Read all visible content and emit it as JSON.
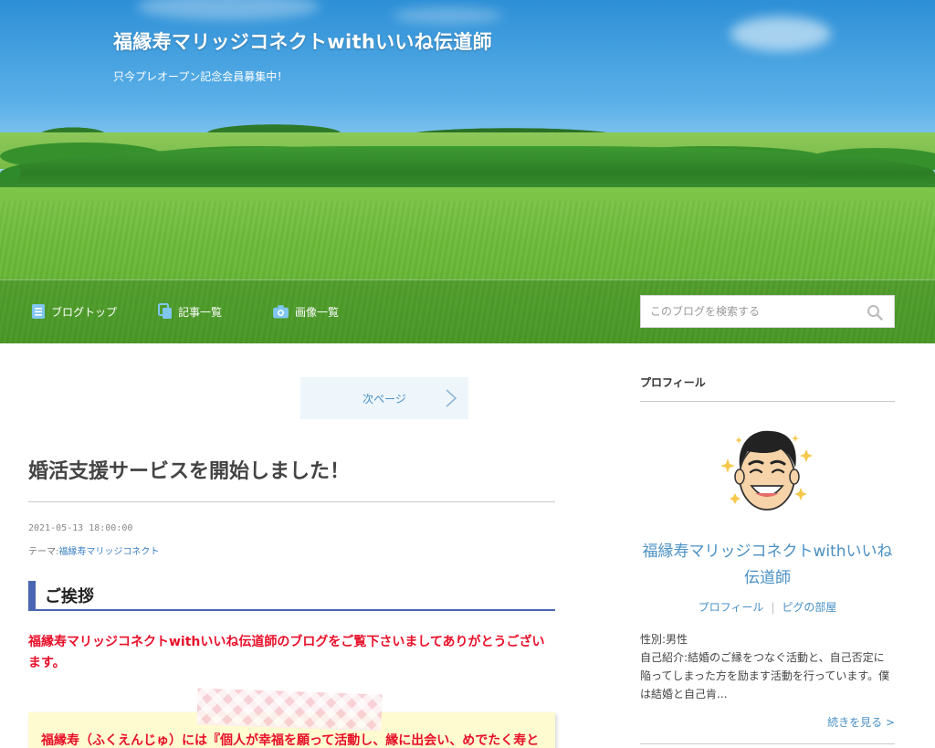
{
  "header": {
    "site_title": "福縁寿マリッジコネクトwithいいね伝道師",
    "site_description": "只今プレオープン記念会員募集中！"
  },
  "nav": {
    "items": [
      {
        "label": "ブログトップ",
        "icon": "list-document-icon"
      },
      {
        "label": "記事一覧",
        "icon": "copy-pages-icon"
      },
      {
        "label": "画像一覧",
        "icon": "camera-icon"
      }
    ],
    "search_placeholder": "このブログを検索する",
    "search_icon": "magnifier-icon"
  },
  "pager": {
    "next_label": "次ページ"
  },
  "post": {
    "title": "婚活支援サービスを開始しました！",
    "date": "2021-05-13 18:00:00",
    "theme_prefix": "テーマ:",
    "theme_link": "福縁寿マリッジコネクト",
    "section_heading": "ご挨拶",
    "greeting": "福縁寿マリッジコネクトwithいいね伝道師のブログをご覧下さいましてありがとうございます。",
    "note_text": "福縁寿（ふくえんじゅ）には『個人が幸福を願って活動し、縁に出会い、めでたく寿と"
  },
  "sidebar": {
    "profile_heading": "プロフィール",
    "profile_name": "福縁寿マリッジコネクトwithいいね伝道師",
    "link_profile": "プロフィール",
    "link_separator": "|",
    "link_room": "ピグの部屋",
    "gender": "性別:男性",
    "intro": "自己紹介:結婚のご縁をつなぐ活動と、自己否定に陥ってしまった方を励ます活動を行っています。僕は結婚と自己肯...",
    "read_more": "続きを見る >"
  },
  "colors": {
    "link_blue": "#4a90c4",
    "accent_red": "#e8102a",
    "heading_bar": "#4a66b0"
  }
}
